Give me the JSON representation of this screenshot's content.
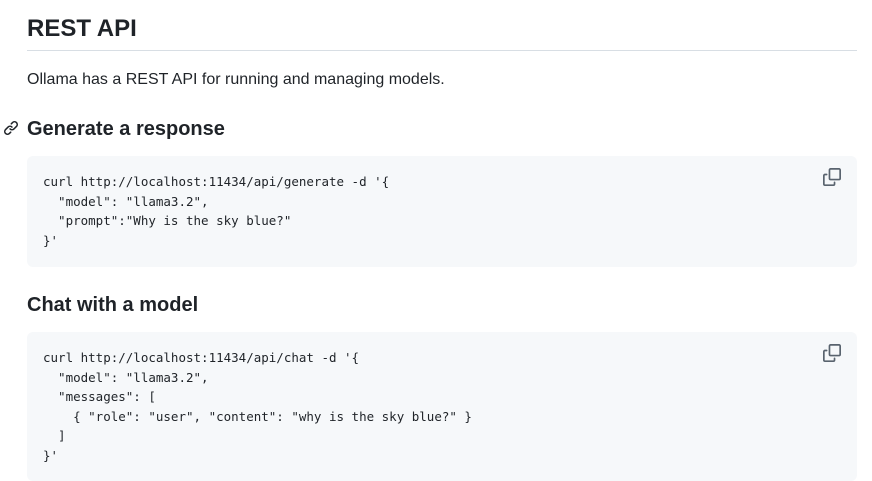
{
  "rest_api": {
    "heading": "REST API",
    "intro": "Ollama has a REST API for running and managing models."
  },
  "generate": {
    "heading": "Generate a response",
    "code": "curl http://localhost:11434/api/generate -d '{\n  \"model\": \"llama3.2\",\n  \"prompt\":\"Why is the sky blue?\"\n}'"
  },
  "chat": {
    "heading": "Chat with a model",
    "code": "curl http://localhost:11434/api/chat -d '{\n  \"model\": \"llama3.2\",\n  \"messages\": [\n    { \"role\": \"user\", \"content\": \"why is the sky blue?\" }\n  ]\n}'"
  },
  "icons": {
    "anchor": "link-icon",
    "copy": "copy-icon"
  },
  "colors": {
    "text": "#1f2328",
    "code_background": "#f6f8fa",
    "divider": "#d8dee4",
    "icon": "#59636e"
  }
}
